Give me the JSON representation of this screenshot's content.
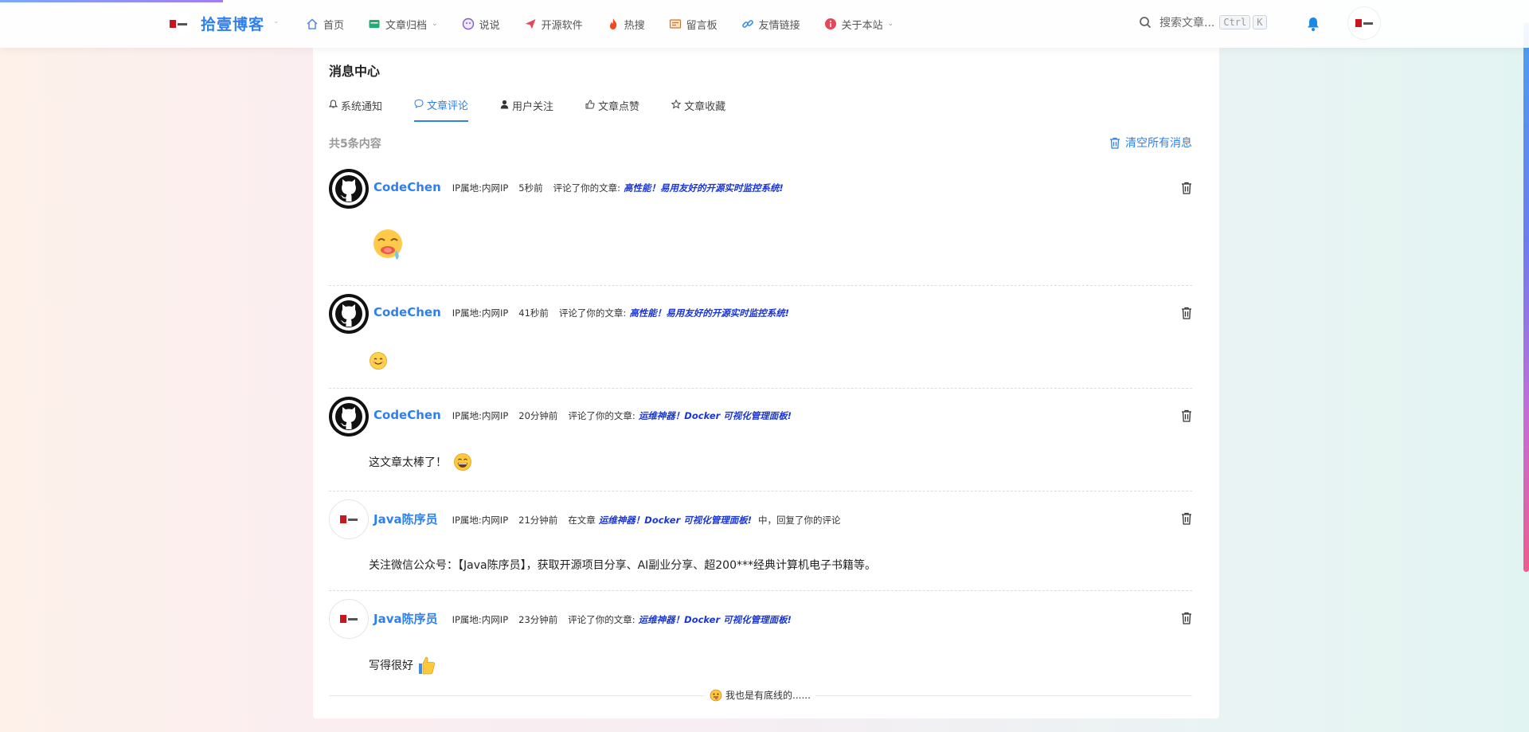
{
  "header": {
    "site_name": "拾壹博客",
    "nav": [
      {
        "label": "首页",
        "icon": "home-icon",
        "color": "#5b8def",
        "dropdown": false
      },
      {
        "label": "文章归档",
        "icon": "folder-icon",
        "color": "#1fae6f",
        "dropdown": true
      },
      {
        "label": "说说",
        "icon": "chat-bubble-icon",
        "color": "#7b5cd6",
        "dropdown": false
      },
      {
        "label": "开源软件",
        "icon": "paper-plane-icon",
        "color": "#e8475a",
        "dropdown": false
      },
      {
        "label": "热搜",
        "icon": "fire-icon",
        "color": "#f24a1f",
        "dropdown": false
      },
      {
        "label": "留言板",
        "icon": "message-board-icon",
        "color": "#c97b3a",
        "dropdown": false
      },
      {
        "label": "友情链接",
        "icon": "link-icon",
        "color": "#3a8ee8",
        "dropdown": false
      },
      {
        "label": "关于本站",
        "icon": "info-icon",
        "color": "#e8475a",
        "dropdown": true
      }
    ],
    "search_placeholder": "搜索文章...",
    "shortcut_keys": [
      "Ctrl",
      "K"
    ]
  },
  "page": {
    "title": "消息中心",
    "tabs": [
      {
        "label": "系统通知",
        "icon": "bell-outline-icon",
        "active": false
      },
      {
        "label": "文章评论",
        "icon": "comment-icon",
        "active": true
      },
      {
        "label": "用户关注",
        "icon": "user-icon",
        "active": false
      },
      {
        "label": "文章点赞",
        "icon": "thumb-up-icon",
        "active": false
      },
      {
        "label": "文章收藏",
        "icon": "star-outline-icon",
        "active": false
      }
    ],
    "count_text": "共5条内容",
    "clear_all_label": "清空所有消息",
    "footer_text": "我也是有底线的......"
  },
  "messages": [
    {
      "user": "CodeChen",
      "avatar": "github-avatar",
      "location": "IP属地:内网IP",
      "time": "5秒前",
      "action_prefix": "评论了你的文章:",
      "article": "高性能！易用友好的开源实时监控系统!",
      "action_suffix": "",
      "content": "",
      "emoji": "drooling-face-emoji"
    },
    {
      "user": "CodeChen",
      "avatar": "github-avatar",
      "location": "IP属地:内网IP",
      "time": "41秒前",
      "action_prefix": "评论了你的文章:",
      "article": "高性能！易用友好的开源实时监控系统!",
      "action_suffix": "",
      "content": "",
      "emoji": "smiling-face-emoji"
    },
    {
      "user": "CodeChen",
      "avatar": "github-avatar",
      "location": "IP属地:内网IP",
      "time": "20分钟前",
      "action_prefix": "评论了你的文章:",
      "article": "运维神器！Docker 可视化管理面板!",
      "action_suffix": "",
      "content": "这文章太棒了！",
      "emoji": "grinning-face-emoji"
    },
    {
      "user": "Java陈序员",
      "avatar": "brand-avatar",
      "location": "IP属地:内网IP",
      "time": "21分钟前",
      "action_prefix": "在文章",
      "article": "运维神器！Docker 可视化管理面板!",
      "action_suffix": "中，回复了你的评论",
      "content": "关注微信公众号：【Java陈序员】，获取开源项目分享、AI副业分享、超200***经典计算机电子书籍等。",
      "emoji": ""
    },
    {
      "user": "Java陈序员",
      "avatar": "brand-avatar",
      "location": "IP属地:内网IP",
      "time": "23分钟前",
      "action_prefix": "评论了你的文章:",
      "article": "运维神器！Docker 可视化管理面板!",
      "action_suffix": "",
      "content": "写得很好",
      "emoji": "thumbs-up-emoji"
    }
  ],
  "colors": {
    "accent": "#2f80ed",
    "article_link": "#1a35d8"
  }
}
